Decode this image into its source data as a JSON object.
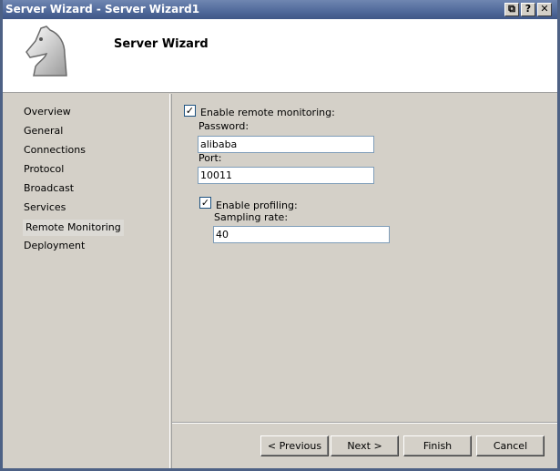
{
  "window": {
    "title": "Server Wizard - Server Wizard1",
    "buttons": {
      "restore": "⧉",
      "help": "?",
      "close": "✕"
    }
  },
  "header": {
    "title": "Server Wizard",
    "logo_icon": "chess-knight-icon"
  },
  "nav": {
    "items": [
      {
        "label": "Overview"
      },
      {
        "label": "General"
      },
      {
        "label": "Connections"
      },
      {
        "label": "Protocol"
      },
      {
        "label": "Broadcast"
      },
      {
        "label": "Services"
      },
      {
        "label": "Remote Monitoring",
        "selected": true
      },
      {
        "label": "Deployment"
      }
    ]
  },
  "remote_monitoring": {
    "enable_label": "Enable remote monitoring:",
    "enable_checked": true,
    "password_label": "Password:",
    "password_value": "alibaba",
    "port_label": "Port:",
    "port_value": "10011",
    "profiling_label": "Enable profiling:",
    "profiling_checked": true,
    "sampling_label": "Sampling rate:",
    "sampling_value": "40"
  },
  "footer": {
    "previous_label": "< Previous",
    "next_label": "Next >",
    "finish_label": "Finish",
    "cancel_label": "Cancel"
  },
  "colors": {
    "titlebar": "#50699a",
    "window_bg": "#d4d0c8",
    "border": "#4d6185"
  }
}
